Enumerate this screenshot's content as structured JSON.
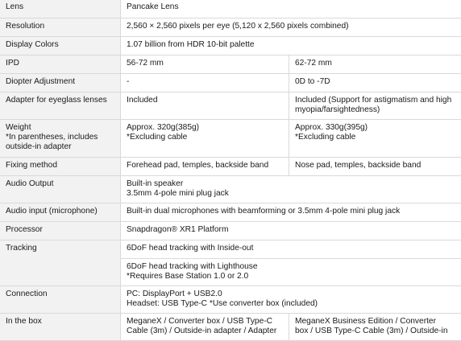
{
  "rows": {
    "lens": {
      "label": "Lens",
      "value": "Pancake Lens"
    },
    "resolution": {
      "label": "Resolution",
      "value": "2,560 ×  2,560 pixels per eye  (5,120 x 2,560 pixels combined)"
    },
    "display_colors": {
      "label": "Display Colors",
      "value": "1.07 billion from HDR 10-bit palette"
    },
    "ipd": {
      "label": "IPD",
      "value_a": "56-72 mm",
      "value_b": "62-72 mm"
    },
    "diopter": {
      "label": "Diopter Adjustment",
      "value_a": "-",
      "value_b": "0D to -7D"
    },
    "eyeglass_adapter": {
      "label": "Adapter for eyeglass lenses",
      "value_a": "Included",
      "value_b": "Included (Support for astigmatism and high myopia/farsightedness)"
    },
    "weight": {
      "label_lines": [
        "Weight",
        "*In parentheses, includes",
        "outside-in adapter"
      ],
      "value_a_lines": [
        "Approx. 320g(385g)",
        "*Excluding cable"
      ],
      "value_b_lines": [
        "Approx. 330g(395g)",
        "*Excluding cable"
      ]
    },
    "fixing_method": {
      "label": "Fixing method",
      "value_a": "Forehead pad, temples, backside band",
      "value_b": "Nose pad,  temples, backside band"
    },
    "audio_output": {
      "label": "Audio Output",
      "value_lines": [
        "Built-in speaker",
        "3.5mm 4-pole mini plug jack"
      ]
    },
    "audio_input": {
      "label": "Audio input (microphone)",
      "value": "Built-in dual microphones with beamforming or 3.5mm 4-pole mini plug jack"
    },
    "processor": {
      "label": "Processor",
      "value": "Snapdragon® XR1 Platform"
    },
    "tracking": {
      "label": "Tracking",
      "value_1": "6DoF head tracking with Inside-out",
      "value_2_lines": [
        "6DoF head tracking with Lighthouse",
        "*Requires Base Station 1.0 or 2.0"
      ]
    },
    "connection": {
      "label": "Connection",
      "value_lines": [
        "PC: DisplayPort + USB2.0",
        "Headset: USB Type-C *Use converter box (included)"
      ]
    },
    "in_the_box": {
      "label": "In the box",
      "value_a_lines": [
        "MeganeX / Converter box / USB Type-C",
        "Cable (3m)  / Outside-in adapter / Adapter"
      ],
      "value_b_lines": [
        "MeganeX Business Edition / Converter",
        "box / USB Type-C Cable (3m)  / Outside-in"
      ]
    }
  }
}
